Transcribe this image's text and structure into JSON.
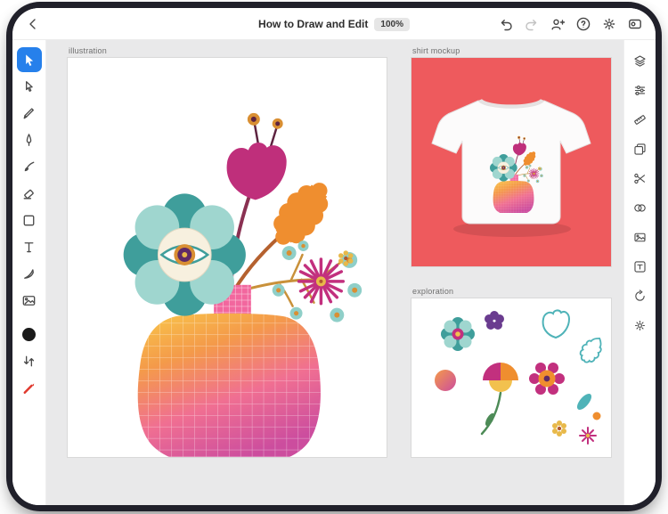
{
  "app": {
    "title": "How to Draw and Edit",
    "zoom_level": "100%"
  },
  "topbar": {
    "back_icon": "chevron-left",
    "right_icons": [
      "undo",
      "redo",
      "invite",
      "help",
      "settings",
      "touch-shortcut"
    ],
    "redo_enabled": false
  },
  "left_toolbar": {
    "tools": [
      "selection",
      "direct-selection",
      "pencil",
      "pen",
      "paintbrush",
      "eraser",
      "shapes",
      "type",
      "knife",
      "place-image"
    ],
    "active_tool": "selection",
    "fill_color": "#1a1a1a",
    "apple_pencil_color": "#e0392e"
  },
  "right_toolbar": {
    "panels": [
      "layers",
      "properties",
      "precision",
      "clipboard",
      "scissors",
      "shape-builder",
      "image",
      "text",
      "history",
      "plugins"
    ]
  },
  "canvas": {
    "artboards": [
      {
        "label": "illustration"
      },
      {
        "label": "shirt mockup"
      },
      {
        "label": "exploration"
      }
    ]
  },
  "palette": {
    "accent_blue": "#2680eb",
    "coral": "#ee5a5d",
    "magenta": "#c2307e",
    "teal_dark": "#3f9e9b",
    "teal_light": "#9fd6cf",
    "orange": "#ef8e2f",
    "mustard": "#e8b94a",
    "purple": "#5f2a66",
    "vase_gradient": [
      "#f9c84a",
      "#f49a4a",
      "#f06f92",
      "#cc4d9e"
    ]
  }
}
